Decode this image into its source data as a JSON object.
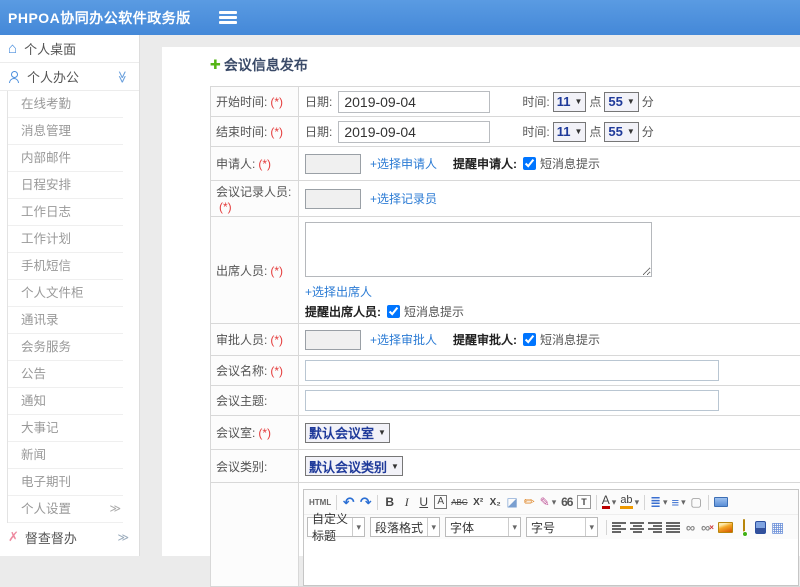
{
  "header": {
    "title": "PHPOA协同办公软件政务版",
    "menu_icon": "hamburger-bars"
  },
  "sidebar": {
    "desktop_label": "个人桌面",
    "desktop_icon": "⌂",
    "office_label": "个人办公",
    "chevron_down": "≫",
    "sub_items": [
      "在线考勤",
      "消息管理",
      "内部邮件",
      "日程安排",
      "工作日志",
      "工作计划",
      "手机短信",
      "个人文件柜",
      "通讯录",
      "会务服务",
      "公告",
      "通知",
      "大事记",
      "新闻",
      "电子期刊"
    ],
    "settings_label": "个人设置",
    "arrow_right": "≫",
    "supervise_label": "督查督办",
    "supervise_icon": "✗"
  },
  "page": {
    "title": "会议信息发布",
    "plus_icon": "✚"
  },
  "form": {
    "required": "(*)",
    "select_caret": "▼",
    "start_time": {
      "label": "开始时间:",
      "date_label": "日期:",
      "date_value": "2019-09-04",
      "time_label": "时间:",
      "hour": "11",
      "hour_unit": "点",
      "minute": "55",
      "minute_unit": "分"
    },
    "end_time": {
      "label": "结束时间:",
      "date_label": "日期:",
      "date_value": "2019-09-04",
      "time_label": "时间:",
      "hour": "11",
      "hour_unit": "点",
      "minute": "55",
      "minute_unit": "分"
    },
    "applicant": {
      "label": "申请人:",
      "link": "+选择申请人",
      "remind": "提醒申请人:",
      "sms": "短消息提示"
    },
    "recorder": {
      "label": "会议记录人员:",
      "link": "+选择记录员"
    },
    "attendees": {
      "label": "出席人员:",
      "link": "+选择出席人",
      "remind": "提醒出席人员:",
      "sms": "短消息提示"
    },
    "approver": {
      "label": "审批人员:",
      "link": "+选择审批人",
      "remind": "提醒审批人:",
      "sms": "短消息提示"
    },
    "meeting_name": {
      "label": "会议名称:"
    },
    "meeting_subject": {
      "label": "会议主题:"
    },
    "meeting_room": {
      "label": "会议室:",
      "value": "默认会议室"
    },
    "meeting_category": {
      "label": "会议类别:",
      "value": "默认会议类别"
    }
  },
  "editor": {
    "icons": {
      "html": "HTML",
      "undo": "↶",
      "redo": "↷",
      "bold": "B",
      "italic": "I",
      "underline": "U",
      "char_border": "A",
      "strike": "ABC",
      "superscript": "X²",
      "subscript": "X₂",
      "eraser": "◪",
      "brush": "✏",
      "format_pen": "✎",
      "caret": "▾",
      "quote": "66",
      "paste_text": "T",
      "font_color": "A",
      "highlight": "ab",
      "ordered_list": "≣",
      "unordered_list": "≡",
      "new_doc": "▢",
      "link": "∞",
      "unlink": "∞",
      "unlink_x": "×",
      "table": "▦"
    },
    "selects": {
      "custom_title": "自定义标题",
      "paragraph": "段落格式",
      "font": "字体",
      "size": "字号"
    }
  },
  "colors": {
    "header_bg": "#4a8edd",
    "link": "#2b7bd4",
    "accent_green": "#55b515",
    "required": "#e43b3b"
  }
}
